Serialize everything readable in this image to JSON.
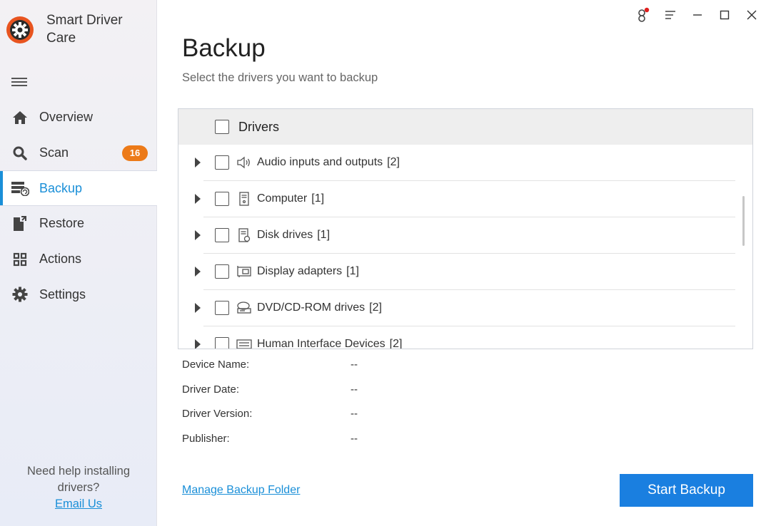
{
  "app": {
    "name": "Smart Driver Care"
  },
  "sidebar": {
    "items": [
      {
        "label": "Overview",
        "icon": "home-icon"
      },
      {
        "label": "Scan",
        "icon": "scan-icon",
        "badge": "16"
      },
      {
        "label": "Backup",
        "icon": "backup-icon",
        "active": true
      },
      {
        "label": "Restore",
        "icon": "restore-icon"
      },
      {
        "label": "Actions",
        "icon": "actions-grid-icon"
      },
      {
        "label": "Settings",
        "icon": "gear-icon"
      }
    ],
    "help_text": "Need help installing drivers?",
    "email_link": "Email Us"
  },
  "window_controls": [
    "account-icon",
    "menu-icon",
    "minimize-icon",
    "maximize-icon",
    "close-icon"
  ],
  "page": {
    "title": "Backup",
    "subtitle": "Select the drivers you want to backup"
  },
  "drivers": {
    "header": "Drivers",
    "rows": [
      {
        "label": "Audio inputs and outputs",
        "count": "[2]",
        "icon": "speaker-icon"
      },
      {
        "label": "Computer",
        "count": "[1]",
        "icon": "computer-icon"
      },
      {
        "label": "Disk drives",
        "count": "[1]",
        "icon": "disk-drive-icon"
      },
      {
        "label": "Display adapters",
        "count": "[1]",
        "icon": "display-adapter-icon"
      },
      {
        "label": "DVD/CD-ROM drives",
        "count": "[2]",
        "icon": "dvd-drive-icon"
      },
      {
        "label": "Human Interface Devices",
        "count": "[2]",
        "icon": "keyboard-icon"
      }
    ]
  },
  "details": {
    "device_name": {
      "label": "Device Name:",
      "value": "--"
    },
    "driver_date": {
      "label": "Driver Date:",
      "value": "--"
    },
    "driver_version": {
      "label": "Driver Version:",
      "value": "--"
    },
    "publisher": {
      "label": "Publisher:",
      "value": "--"
    }
  },
  "footer": {
    "manage_link": "Manage Backup Folder",
    "start_button": "Start Backup"
  },
  "colors": {
    "accent": "#1a8fd8",
    "button": "#1a7fe0",
    "badge": "#ec7a18"
  }
}
